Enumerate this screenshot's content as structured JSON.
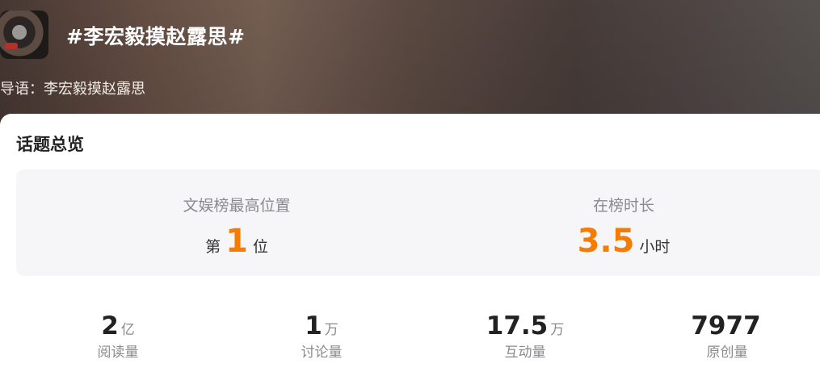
{
  "header": {
    "title": "#李宏毅摸赵露思#",
    "guide": "导语：李宏毅摸赵露思"
  },
  "overview": {
    "title": "话题总览",
    "rank": {
      "label": "文娱榜最高位置",
      "prefix": "第",
      "value": "1",
      "suffix": "位"
    },
    "duration": {
      "label": "在榜时长",
      "value": "3.5",
      "unit": "小时"
    }
  },
  "stats": [
    {
      "value": "2",
      "unit": "亿",
      "label": "阅读量"
    },
    {
      "value": "1",
      "unit": "万",
      "label": "讨论量"
    },
    {
      "value": "17.5",
      "unit": "万",
      "label": "互动量"
    },
    {
      "value": "7977",
      "unit": "",
      "label": "原创量"
    }
  ],
  "colors": {
    "accent": "#f57c00",
    "panel": "#f6f6f9"
  }
}
